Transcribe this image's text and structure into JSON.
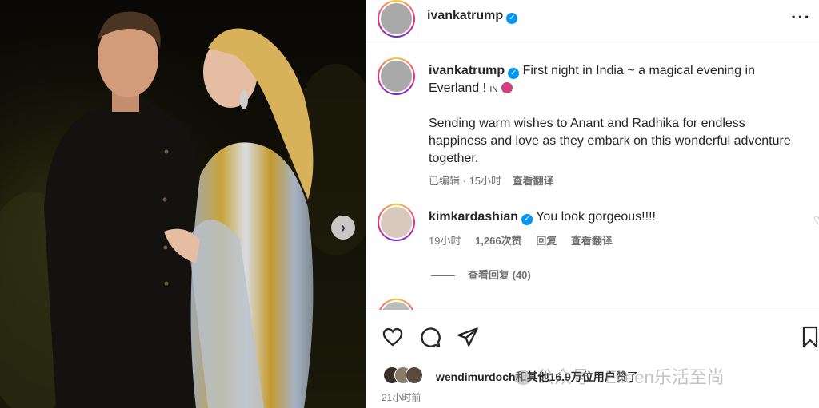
{
  "header": {
    "username": "ivankatrump",
    "more_icon": "more-horizontal-icon"
  },
  "caption": {
    "username": "ivankatrump",
    "line1": "First night in India ~ a magical evening in",
    "line2": "Everland !",
    "flag_text": "IN",
    "paragraph": "Sending warm wishes to Anant and Radhika for endless happiness and love as they embark on this wonderful adventure together.",
    "edited": "已编辑",
    "time": "15小时",
    "translate": "查看翻译"
  },
  "comment": {
    "username": "kimkardashian",
    "text": "You look gorgeous!!!!",
    "time": "19小时",
    "likes": "1,266次赞",
    "reply": "回复",
    "translate": "查看翻译",
    "view_replies": "查看回复 (40)"
  },
  "actions": {
    "like_icon": "heart-icon",
    "comment_icon": "comment-icon",
    "share_icon": "share-icon",
    "save_icon": "bookmark-icon"
  },
  "likes": {
    "user": "wendimurdoch",
    "suffix_1": "和",
    "others": "其他16.9万位用户",
    "suffix_2": "赞了"
  },
  "post_time": "21小时前",
  "watermark": "公众号 · Eileen乐活至尚",
  "colors": {
    "verified": "#0095f6",
    "link": "#00376b",
    "text": "#262626",
    "muted": "#737373"
  }
}
